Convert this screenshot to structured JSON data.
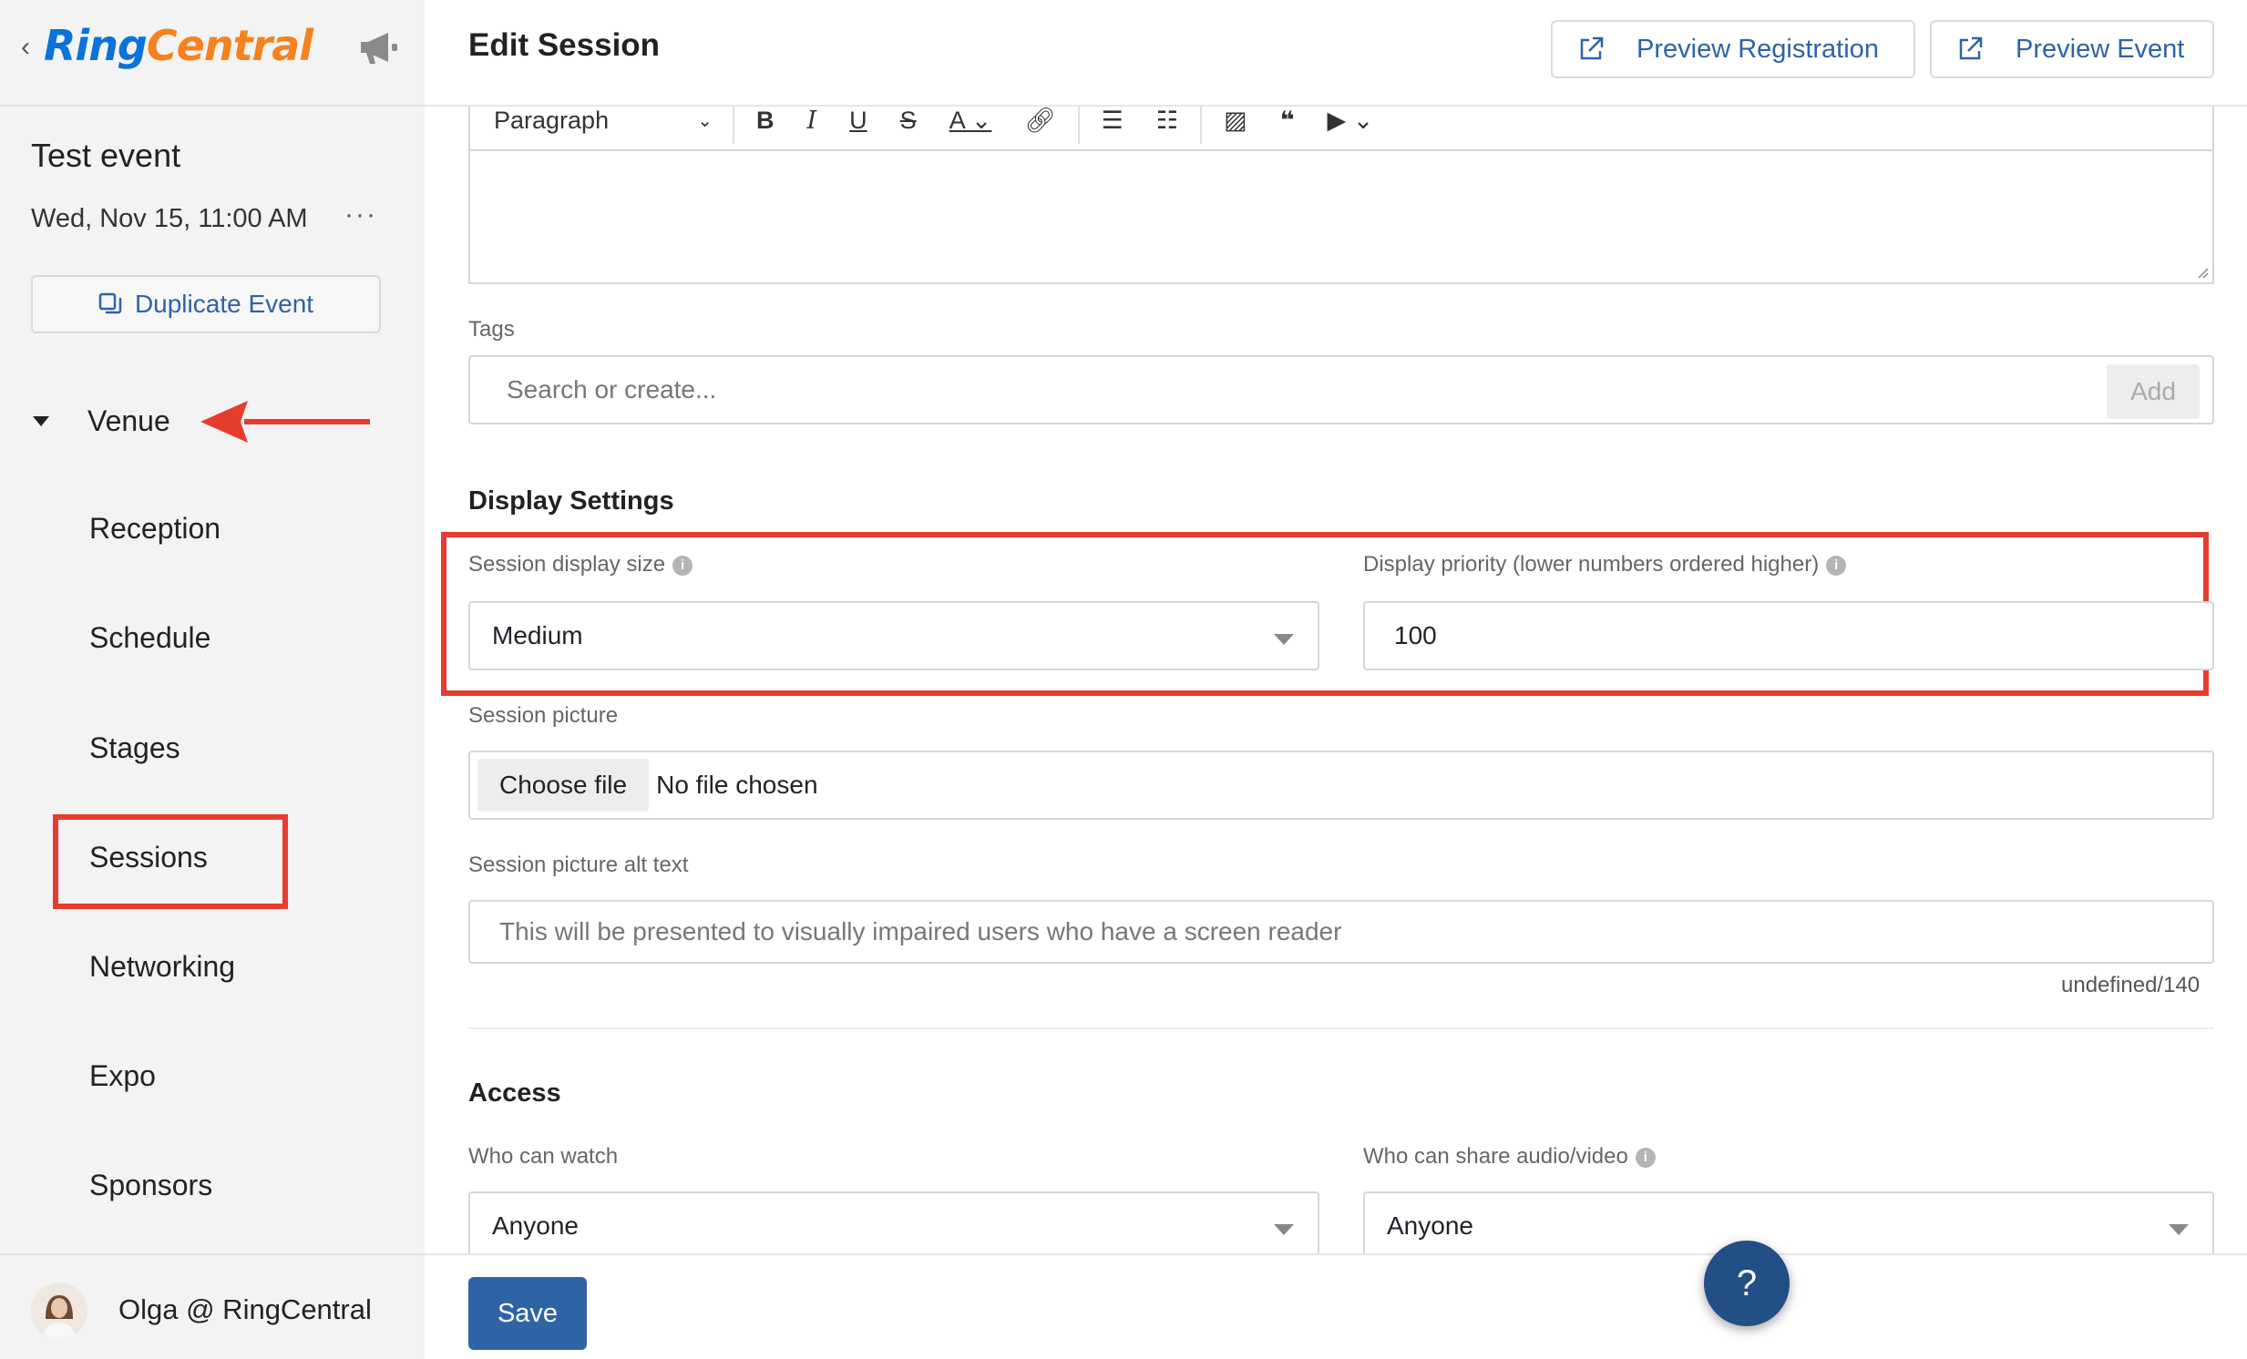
{
  "sidebar": {
    "brand_ring": "Ring",
    "brand_central": "Central",
    "event_title": "Test event",
    "event_date": "Wed, Nov 15, 11:00 AM",
    "event_menu": "···",
    "duplicate_label": "Duplicate Event",
    "venue_label": "Venue",
    "items": [
      "Reception",
      "Schedule",
      "Stages",
      "Sessions",
      "Networking",
      "Expo",
      "Sponsors"
    ],
    "user_name": "Olga @ RingCentral"
  },
  "header": {
    "title": "Edit Session",
    "preview_registration": "Preview Registration",
    "preview_event": "Preview Event"
  },
  "editor": {
    "paragraph_select": "Paragraph",
    "tools": [
      "bold",
      "italic",
      "underline",
      "strikethrough",
      "font-color",
      "link",
      "bullet-list",
      "numbered-list",
      "image",
      "quote",
      "video"
    ]
  },
  "tags": {
    "label": "Tags",
    "placeholder": "Search or create...",
    "add_label": "Add"
  },
  "display_settings": {
    "title": "Display Settings",
    "size_label": "Session display size",
    "size_value": "Medium",
    "priority_label": "Display priority (lower numbers ordered higher)",
    "priority_value": "100"
  },
  "picture": {
    "label": "Session picture",
    "choose_file": "Choose file",
    "no_file": "No file chosen",
    "alt_label": "Session picture alt text",
    "alt_placeholder": "This will be presented to visually impaired users who have a screen reader",
    "counter": "undefined/140"
  },
  "access": {
    "title": "Access",
    "watch_label": "Who can watch",
    "watch_value": "Anyone",
    "share_label": "Who can share audio/video",
    "share_value": "Anyone"
  },
  "footer": {
    "save_label": "Save",
    "help_label": "?"
  },
  "colors": {
    "accent": "#2e64a6",
    "highlight": "#e63c2e",
    "brand_blue": "#0b72d9",
    "brand_orange": "#f5821f"
  }
}
